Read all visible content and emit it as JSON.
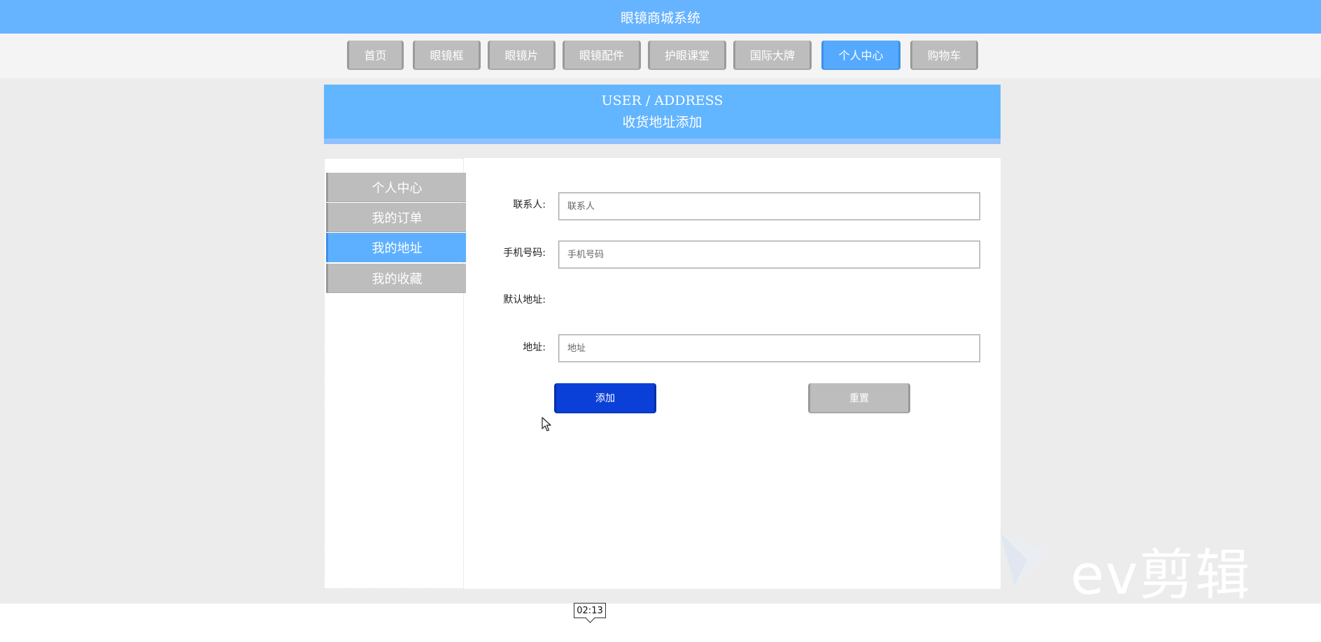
{
  "app": {
    "title": "眼镜商城系统"
  },
  "nav": {
    "items": [
      {
        "label": "首页"
      },
      {
        "label": "眼镜框"
      },
      {
        "label": "眼镜片"
      },
      {
        "label": "眼镜配件"
      },
      {
        "label": "护眼课堂"
      },
      {
        "label": "国际大牌"
      },
      {
        "label": "个人中心",
        "active": true
      },
      {
        "label": "购物车"
      }
    ]
  },
  "banner": {
    "en": "USER / ADDRESS",
    "cn": "收货地址添加"
  },
  "sidebar": {
    "items": [
      {
        "label": "个人中心"
      },
      {
        "label": "我的订单"
      },
      {
        "label": "我的地址",
        "active": true
      },
      {
        "label": "我的收藏"
      }
    ]
  },
  "form": {
    "contact": {
      "label": "联系人:",
      "placeholder": "联系人",
      "value": ""
    },
    "phone": {
      "label": "手机号码:",
      "placeholder": "手机号码",
      "value": ""
    },
    "default_address": {
      "label": "默认地址:"
    },
    "address": {
      "label": "地址:",
      "placeholder": "地址",
      "value": ""
    },
    "add_label": "添加",
    "reset_label": "重置"
  },
  "watermark": {
    "text": "ev剪辑"
  },
  "video": {
    "timestamp": "02:13"
  },
  "colors": {
    "primary": "#66b3ff",
    "active": "#55aaff",
    "add_button": "#0a3fd8",
    "inactive": "#bdbdbd"
  }
}
